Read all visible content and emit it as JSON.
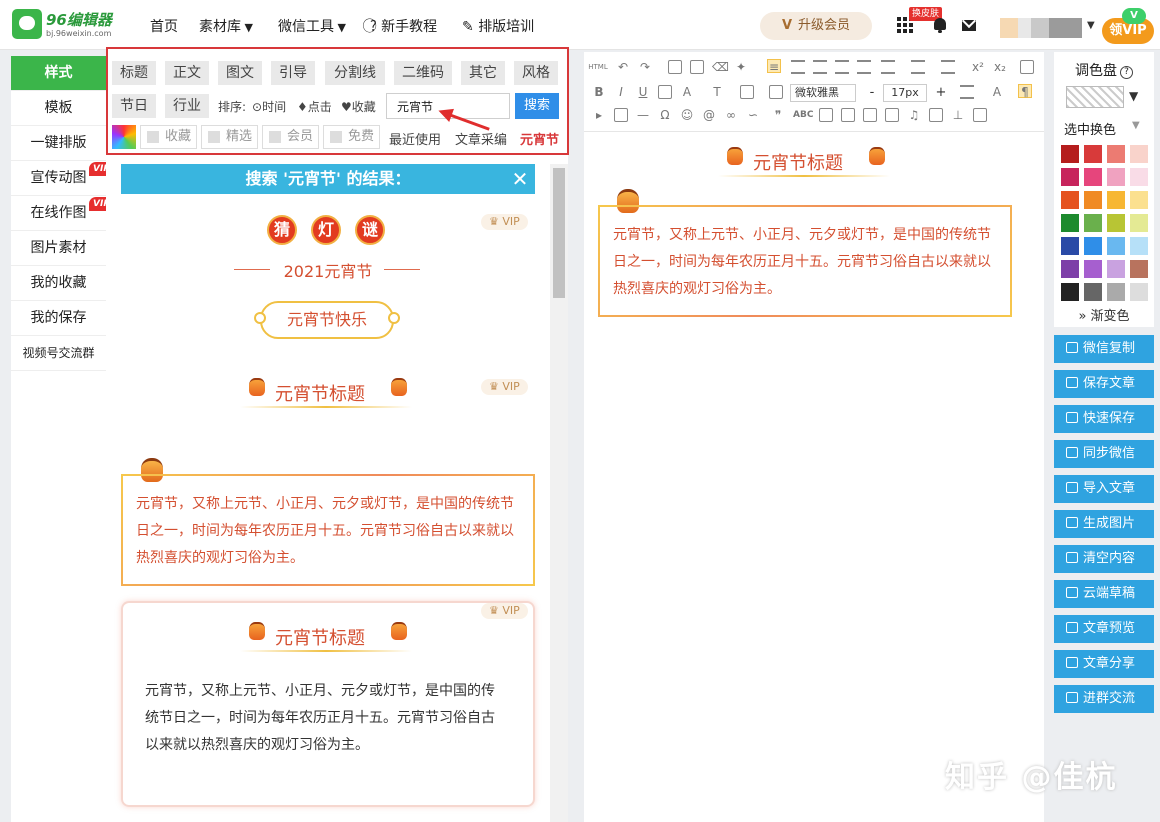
{
  "logo": {
    "name": "96编辑器",
    "url": "bj.96weixin.com"
  },
  "nav": [
    {
      "label": "首页",
      "icon": ""
    },
    {
      "label": "素材库",
      "icon": "caret-down-icon"
    },
    {
      "label": "微信工具",
      "icon": "caret-down-icon"
    },
    {
      "label": "新手教程",
      "icon": "question-circle-icon"
    },
    {
      "label": "排版培训",
      "icon": "edit-icon"
    }
  ],
  "header": {
    "upgrade_label": "升级会员",
    "skin_label": "换皮肤",
    "vip_claim_label": "领VIP",
    "vip_mark": "V"
  },
  "sidebar": {
    "items": [
      {
        "label": "样式",
        "active": true,
        "vip": false
      },
      {
        "label": "模板",
        "active": false,
        "vip": false
      },
      {
        "label": "一键排版",
        "active": false,
        "vip": false
      },
      {
        "label": "宣传动图",
        "active": false,
        "vip": true
      },
      {
        "label": "在线作图",
        "active": false,
        "vip": true
      },
      {
        "label": "图片素材",
        "active": false,
        "vip": false
      },
      {
        "label": "我的收藏",
        "active": false,
        "vip": false
      },
      {
        "label": "我的保存",
        "active": false,
        "vip": false
      },
      {
        "label": "视频号交流群",
        "active": false,
        "vip": false
      }
    ],
    "vip_tag": "VIP"
  },
  "filters": {
    "row1": [
      "标题",
      "正文",
      "图文",
      "引导",
      "分割线",
      "二维码",
      "其它",
      "风格"
    ],
    "row2": [
      "节日",
      "行业"
    ],
    "sort_label": "排序:",
    "sort_options": [
      "时间",
      "点击",
      "收藏"
    ],
    "search_value": "元宵节",
    "search_button": "搜索",
    "checkboxes": [
      "收藏",
      "精选",
      "会员",
      "免费"
    ],
    "links": [
      "最近使用",
      "文章采编"
    ],
    "active_link": "元宵节"
  },
  "results": {
    "header": "搜索 '元宵节' 的结果：",
    "vip_mark": "VIP",
    "riddle_chars": [
      "猜",
      "灯",
      "谜"
    ],
    "festival_year": "2021元宵节",
    "happy_label": "元宵节快乐",
    "title_text": "元宵节标题",
    "body_text": "元宵节，又称上元节、小正月、元夕或灯节，是中国的传统节日之一，时间为每年农历正月十五。元宵节习俗自古以来就以热烈喜庆的观灯习俗为主。"
  },
  "editor": {
    "font_name": "微软雅黑",
    "font_size": "17px",
    "html_label": "HTML",
    "title_text": "元宵节标题",
    "body_text": "元宵节，又称上元节、小正月、元夕或灯节，是中国的传统节日之一，时间为每年农历正月十五。元宵节习俗自古以来就以热烈喜庆的观灯习俗为主。"
  },
  "palette": {
    "title": "调色盘",
    "subtitle": "选中换色",
    "gradient_label": "渐变色",
    "colors": [
      "#b51d1d",
      "#d83a3a",
      "#ec7b72",
      "#f9d3cb",
      "#c7245c",
      "#e6457c",
      "#f0a2c0",
      "#f9dce7",
      "#e5531f",
      "#f08a24",
      "#f7b733",
      "#fbe08f",
      "#1d8a2e",
      "#6ab04c",
      "#b8c534",
      "#e4ea94",
      "#2a4aa6",
      "#2f8ee8",
      "#69b8f0",
      "#b6e0f8",
      "#7d3fa8",
      "#a65fcf",
      "#c9a2e0",
      "#b8735e",
      "#222222",
      "#666666",
      "#aaaaaa",
      "#dddddd"
    ]
  },
  "actions": [
    {
      "label": "微信复制",
      "icon": "copy-icon"
    },
    {
      "label": "保存文章",
      "icon": "save-icon"
    },
    {
      "label": "快速保存",
      "icon": "plus-square-icon"
    },
    {
      "label": "同步微信",
      "icon": "sync-icon"
    },
    {
      "label": "导入文章",
      "icon": "import-icon"
    },
    {
      "label": "生成图片",
      "icon": "image-icon"
    },
    {
      "label": "清空内容",
      "icon": "trash-icon"
    },
    {
      "label": "云端草稿",
      "icon": "cloud-icon"
    },
    {
      "label": "文章预览",
      "icon": "eye-icon"
    },
    {
      "label": "文章分享",
      "icon": "share-icon"
    },
    {
      "label": "进群交流",
      "icon": "group-icon"
    }
  ],
  "watermark": "知乎 @佳杭"
}
